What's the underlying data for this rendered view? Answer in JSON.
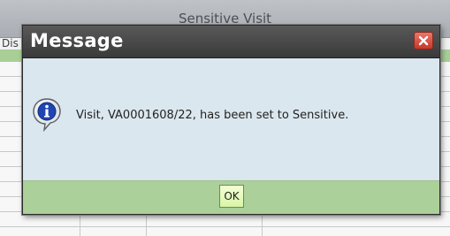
{
  "background": {
    "table_title": "Sensitive Visit",
    "column_label": "Dis"
  },
  "dialog": {
    "title": "Message",
    "message": "Visit, VA0001608/22, has been set to Sensitive.",
    "icon": "info-icon",
    "close_icon": "close-icon",
    "ok_label": "OK"
  },
  "colors": {
    "titlebar": "#3f3f3f",
    "close_button": "#d04a3b",
    "body": "#dbe7ee",
    "footer": "#acd09a",
    "ok_button": "#e4f9b8"
  }
}
